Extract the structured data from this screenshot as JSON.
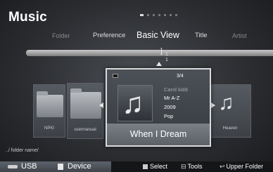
{
  "header": {
    "title": "Music",
    "page_dots": {
      "total": 7,
      "active": 1
    }
  },
  "sort_tabs": [
    {
      "label": "Folder"
    },
    {
      "label": "Preference"
    },
    {
      "label": "Basic View",
      "selected": true
    },
    {
      "label": "Title"
    },
    {
      "label": "Artist"
    }
  ],
  "scrollbar": {
    "marker": "1",
    "index": "1",
    "count": "1"
  },
  "items": {
    "left_1": {
      "label": "NPKI",
      "icon": "folder-icon"
    },
    "left_2": {
      "label": "usermanual",
      "icon": "folder-icon"
    },
    "right_1": {
      "label": "Heaven",
      "icon": "music-note-icon"
    }
  },
  "focus": {
    "counter": "3/4",
    "artist": "Carol kidd",
    "album": "Mr A-Z",
    "year": "2009",
    "genre": "Pop",
    "title": "When I Dream",
    "art_icon": "music-note-icon"
  },
  "path": "../ folder name/",
  "footer": {
    "source_usb": "USB",
    "source_device": "Device",
    "hint_select": "Select",
    "hint_tools": "Tools",
    "hint_upper": "Upper Folder"
  },
  "colors": {
    "accent_highlight": "#d9dadc",
    "background": "#2c2e32",
    "title_bar": "#6b7076"
  }
}
